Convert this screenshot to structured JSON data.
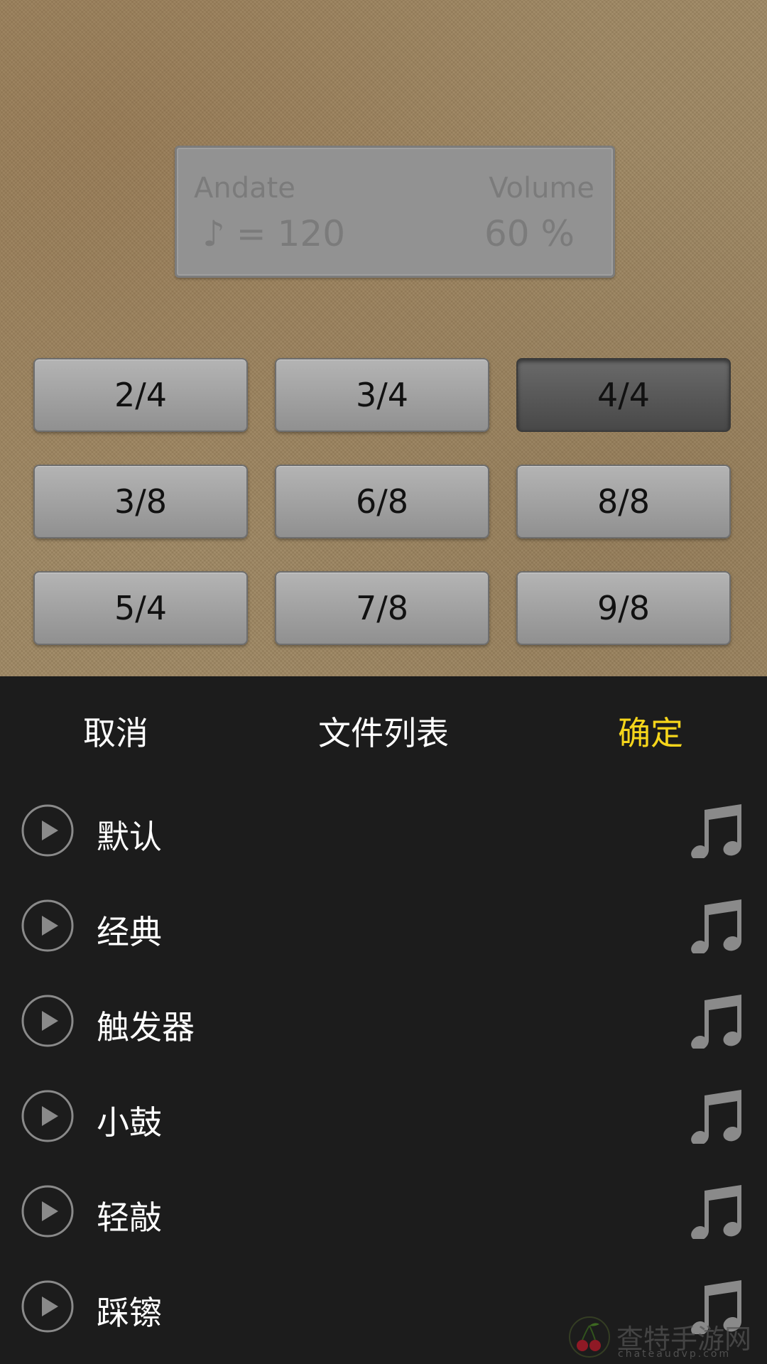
{
  "display": {
    "tempo_label": "Andate",
    "tempo_value": "♪ = 120",
    "volume_label": "Volume",
    "volume_value": "60 %"
  },
  "time_signatures": [
    {
      "label": "2/4",
      "selected": false
    },
    {
      "label": "3/4",
      "selected": false
    },
    {
      "label": "4/4",
      "selected": true
    },
    {
      "label": "3/8",
      "selected": false
    },
    {
      "label": "6/8",
      "selected": false
    },
    {
      "label": "8/8",
      "selected": false
    },
    {
      "label": "5/4",
      "selected": false
    },
    {
      "label": "7/8",
      "selected": false
    },
    {
      "label": "9/8",
      "selected": false
    }
  ],
  "file_list": {
    "cancel_label": "取消",
    "title": "文件列表",
    "confirm_label": "确定",
    "items": [
      {
        "name": "默认"
      },
      {
        "name": "经典"
      },
      {
        "name": "触发器"
      },
      {
        "name": "小鼓"
      },
      {
        "name": "轻敲"
      },
      {
        "name": "踩镲"
      }
    ]
  },
  "watermark": {
    "text": "查特手游网",
    "url": "chateaudvp.com"
  },
  "colors": {
    "confirm": "#f5d51b",
    "sheet_bg": "#1c1c1c",
    "icon_gray": "#8a8a8a"
  }
}
